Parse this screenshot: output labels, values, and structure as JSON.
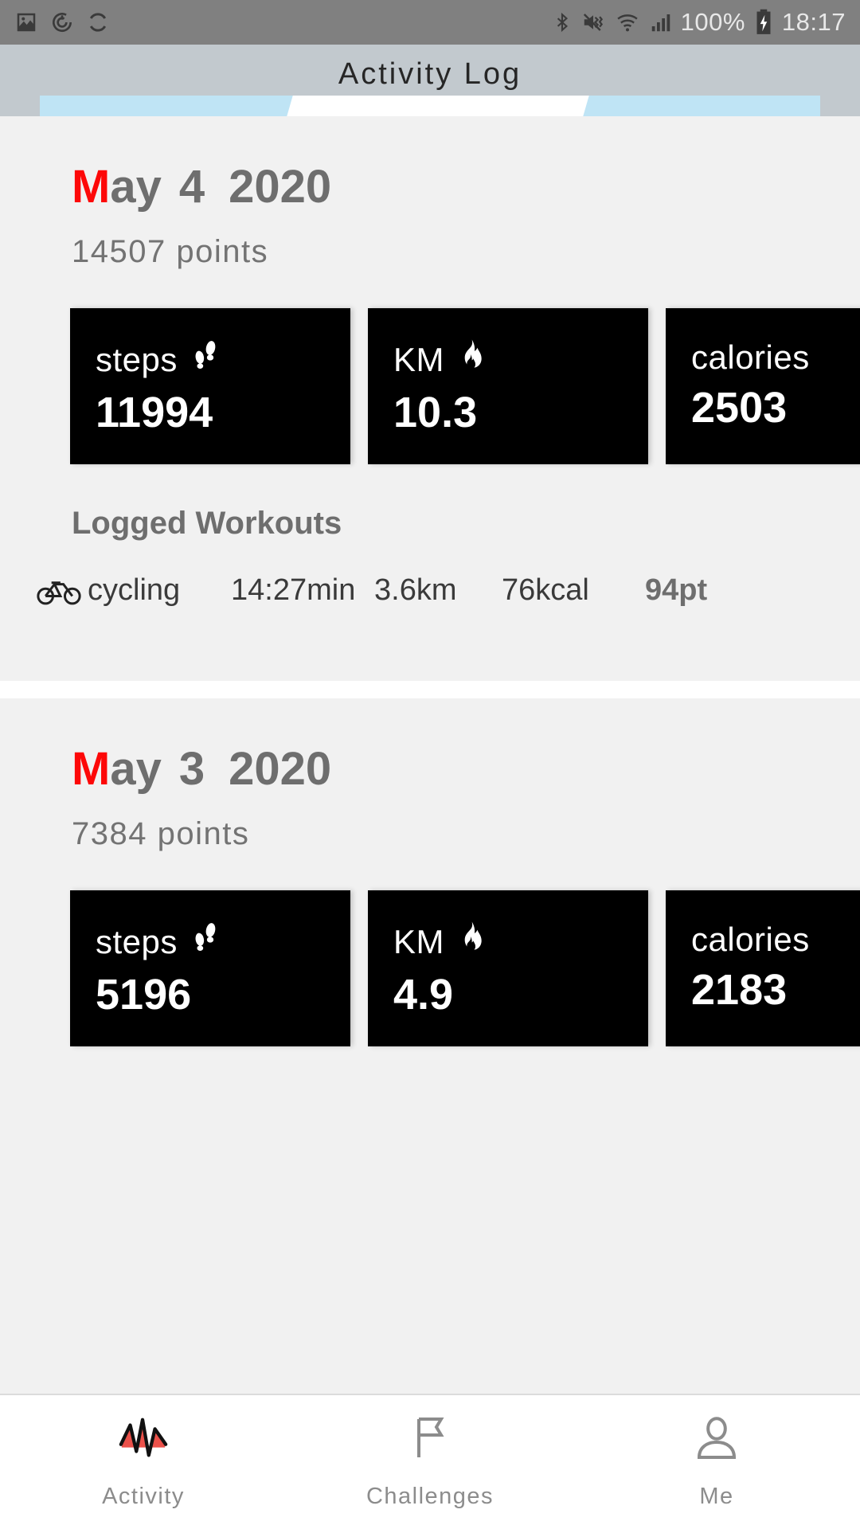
{
  "status_bar": {
    "left_icons": [
      "image-icon",
      "power-restart-icon",
      "sync-icon"
    ],
    "right_icons": [
      "bluetooth-icon",
      "mute-vibrate-icon",
      "wifi-icon",
      "cell-signal-icon",
      "battery-charging-icon"
    ],
    "battery_percent": "100%",
    "clock": "18:17"
  },
  "app_bar": {
    "title": "Activity Log"
  },
  "days": [
    {
      "month": "May",
      "month_first_letter": "M",
      "month_rest": "ay",
      "day": "4",
      "year": "2020",
      "points": "14507 points",
      "cards": [
        {
          "label": "steps",
          "icon": "footprints-icon",
          "value": "11994"
        },
        {
          "label": "KM",
          "icon": "flame-icon",
          "value": "10.3"
        },
        {
          "label": "calories",
          "icon": "",
          "value": "2503"
        }
      ],
      "workouts_title": "Logged Workouts",
      "workouts": [
        {
          "icon": "bicycle-icon",
          "name": "cycling",
          "duration": "14:27min",
          "distance": "3.6km",
          "calories": "76kcal",
          "points": "94pt"
        }
      ]
    },
    {
      "month": "May",
      "month_first_letter": "M",
      "month_rest": "ay",
      "day": "3",
      "year": "2020",
      "points": "7384 points",
      "cards": [
        {
          "label": "steps",
          "icon": "footprints-icon",
          "value": "5196"
        },
        {
          "label": "KM",
          "icon": "flame-icon",
          "value": "4.9"
        },
        {
          "label": "calories",
          "icon": "",
          "value": "2183"
        }
      ]
    }
  ],
  "bottom_nav": [
    {
      "label": "Activity",
      "icon": "pulse-icon",
      "active": true
    },
    {
      "label": "Challenges",
      "icon": "flag-icon",
      "active": false
    },
    {
      "label": "Me",
      "icon": "person-icon",
      "active": false
    }
  ],
  "colors": {
    "accent_red": "#fd0808",
    "card_bg": "#000000",
    "page_bg": "#f1f1f1",
    "app_bar_bg": "#c2c9ce",
    "indicator_blue": "#bfe4f5"
  }
}
